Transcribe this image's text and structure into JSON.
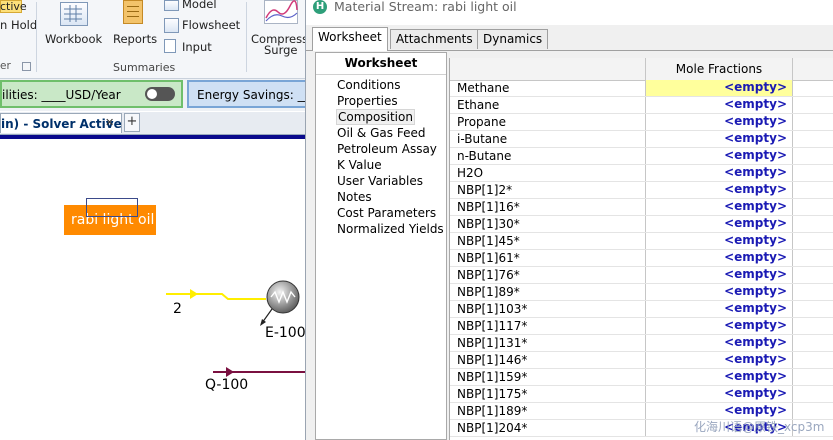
{
  "ribbon": {
    "top_left_label": "ctive",
    "hold_label": "n Hold",
    "workbook_label": "Workbook",
    "reports_label": "Reports",
    "model_label": "Model",
    "flowsheet_label": "Flowsheet",
    "input_label": "Input",
    "compress_label_1": "Compress",
    "compress_label_2": "Surge",
    "group_left_label": "er",
    "summaries_label": "Summaries"
  },
  "utilities": {
    "label": "ilities: ____USD/Year"
  },
  "energy": {
    "label": "Energy Savings: __"
  },
  "doc_tab": {
    "label": "in) - Solver Active",
    "close": "✕",
    "add": "+"
  },
  "flowsheet": {
    "stream_name": "rabi light oil",
    "stream_2": "2",
    "exchanger": "E-100",
    "energy_stream": "Q-100"
  },
  "dialog": {
    "title": "Material Stream: rabi light oil",
    "tabs": [
      "Worksheet",
      "Attachments",
      "Dynamics"
    ],
    "nav_header": "Worksheet",
    "nav_items": [
      "Conditions",
      "Properties",
      "Composition",
      "Oil & Gas Feed",
      "Petroleum Assay",
      "K Value",
      "User Variables",
      "Notes",
      "Cost Parameters",
      "Normalized Yields"
    ],
    "grid_header": "Mole Fractions",
    "empty_text": "<empty>",
    "components": [
      "Methane",
      "Ethane",
      "Propane",
      "i-Butane",
      "n-Butane",
      "H2O",
      "NBP[1]2*",
      "NBP[1]16*",
      "NBP[1]30*",
      "NBP[1]45*",
      "NBP[1]61*",
      "NBP[1]76*",
      "NBP[1]89*",
      "NBP[1]103*",
      "NBP[1]117*",
      "NBP[1]131*",
      "NBP[1]146*",
      "NBP[1]159*",
      "NBP[1]175*",
      "NBP[1]189*",
      "NBP[1]204*"
    ]
  },
  "watermark": "化海川语@原铁_xcp3m",
  "colors": {
    "stream_label_bg": "#ff8a00",
    "material_stream": "#ffee00",
    "energy_stream": "#7a1040",
    "empty_value": "#1a1ab4",
    "selected_cell": "#ffff9c",
    "solver_line": "#0a0a8c"
  }
}
